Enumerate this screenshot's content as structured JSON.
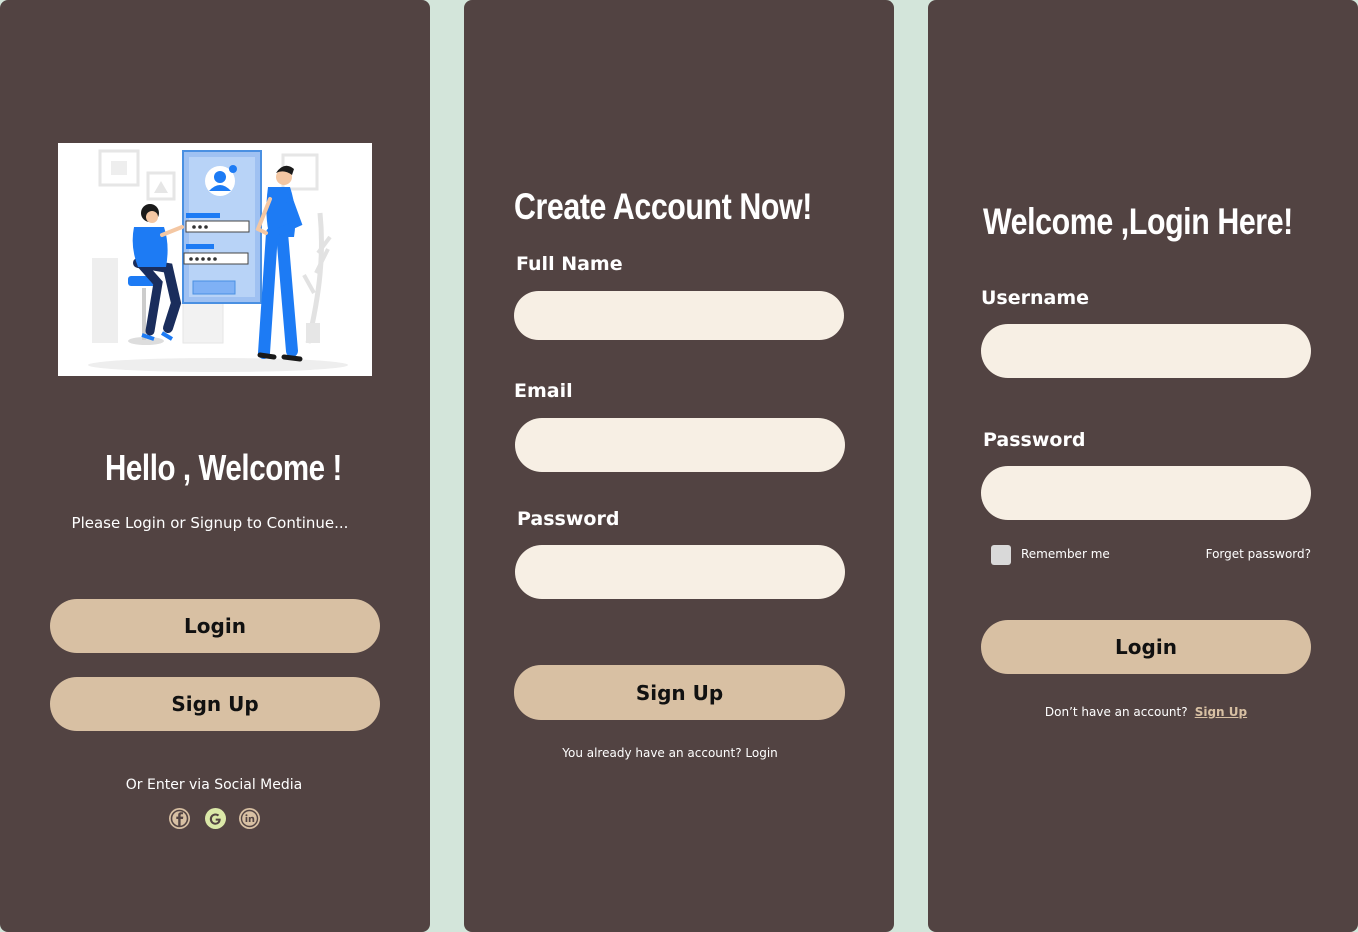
{
  "welcome": {
    "title": "Hello , Welcome !",
    "subtitle": "Please Login or Signup to Continue...",
    "login_label": "Login",
    "signup_label": "Sign Up",
    "social_text": "Or Enter via Social Media",
    "social_icons": [
      "facebook-icon",
      "google-icon",
      "linkedin-icon"
    ]
  },
  "signup": {
    "title": "Create Account Now!",
    "fullname_label": "Full Name",
    "fullname_value": "",
    "email_label": "Email",
    "email_value": "",
    "password_label": "Password",
    "password_value": "",
    "submit_label": "Sign Up",
    "footer_text": "You already have an account? Login"
  },
  "login": {
    "title": "Welcome ,Login Here!",
    "username_label": "Username",
    "username_value": "",
    "password_label": "Password",
    "password_value": "",
    "remember_label": "Remember me",
    "remember_checked": false,
    "forgot_label": "Forget password?",
    "submit_label": "Login",
    "footer_prefix": "Don’t have an account?",
    "footer_link": "Sign Up"
  },
  "colors": {
    "page_bg": "#d3e5da",
    "panel_bg": "#524342",
    "field_bg": "#f7efe4",
    "button_bg": "#d8c0a3",
    "illustration_accent": "#1d7bf4"
  }
}
